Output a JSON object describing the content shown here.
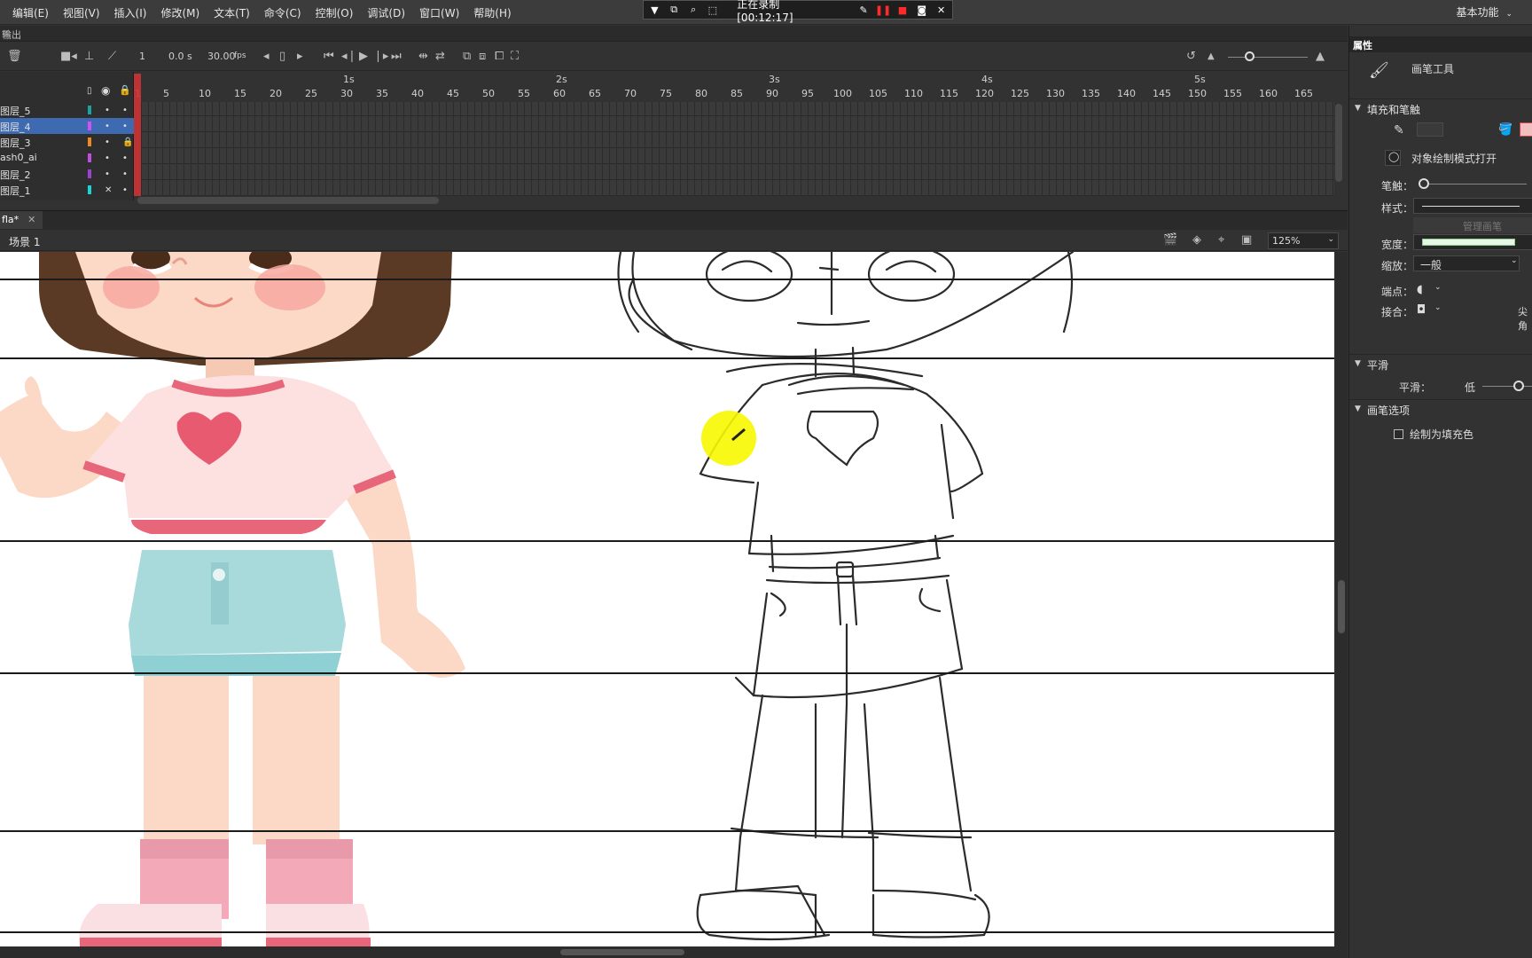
{
  "menu": {
    "items": [
      "编辑(E)",
      "视图(V)",
      "插入(I)",
      "修改(M)",
      "文本(T)",
      "命令(C)",
      "控制(O)",
      "调试(D)",
      "窗口(W)",
      "帮助(H)"
    ]
  },
  "workspace": {
    "label": "基本功能"
  },
  "recording": {
    "status": "正在录制 [00:12:17]"
  },
  "output_panel": {
    "title": "输出"
  },
  "timeline": {
    "current_frame": "1",
    "time": "0.0 s",
    "fps_value": "30.00",
    "fps_unit": "fps",
    "seconds": [
      "1s",
      "2s",
      "3s",
      "4s",
      "5s"
    ],
    "frame_numbers": [
      "1",
      "5",
      "10",
      "15",
      "20",
      "25",
      "30",
      "35",
      "40",
      "45",
      "50",
      "55",
      "60",
      "65",
      "70",
      "75",
      "80",
      "85",
      "90",
      "95",
      "100",
      "105",
      "110",
      "115",
      "120",
      "125",
      "130",
      "135",
      "140",
      "145",
      "150",
      "155",
      "160",
      "165"
    ],
    "layers": [
      {
        "name": "图层_5",
        "color": "#1aa3a3",
        "selected": false,
        "locked": false
      },
      {
        "name": "图层_4",
        "color": "#d64ef5",
        "selected": true,
        "locked": false
      },
      {
        "name": "图层_3",
        "color": "#f08a1e",
        "selected": false,
        "locked": true
      },
      {
        "name": "ash0_ai",
        "color": "#c04ee0",
        "selected": false,
        "locked": false
      },
      {
        "name": "图层_2",
        "color": "#a040d0",
        "selected": false,
        "locked": false
      },
      {
        "name": "图层_1",
        "color": "#19d5d5",
        "selected": false,
        "locked": false
      }
    ]
  },
  "document": {
    "tab": "fla*",
    "scene": "场景 1",
    "zoom": "125%"
  },
  "properties": {
    "title": "属性",
    "tool_name": "画笔工具",
    "section_fill_stroke": "填充和笔触",
    "object_draw_mode": "对象绘制模式打开",
    "stroke_label": "笔触：",
    "style_label": "样式：",
    "manage_brush": "管理画笔",
    "width_label": "宽度：",
    "scale_label": "缩放：",
    "scale_value": "一般",
    "cap_label": "端点：",
    "join_label": "接合：",
    "join_extra": "尖角",
    "section_smooth": "平滑",
    "smooth_label": "平滑：",
    "smooth_value": "低",
    "section_brush_options": "画笔选项",
    "fill_as_color": "绘制为填充色"
  }
}
